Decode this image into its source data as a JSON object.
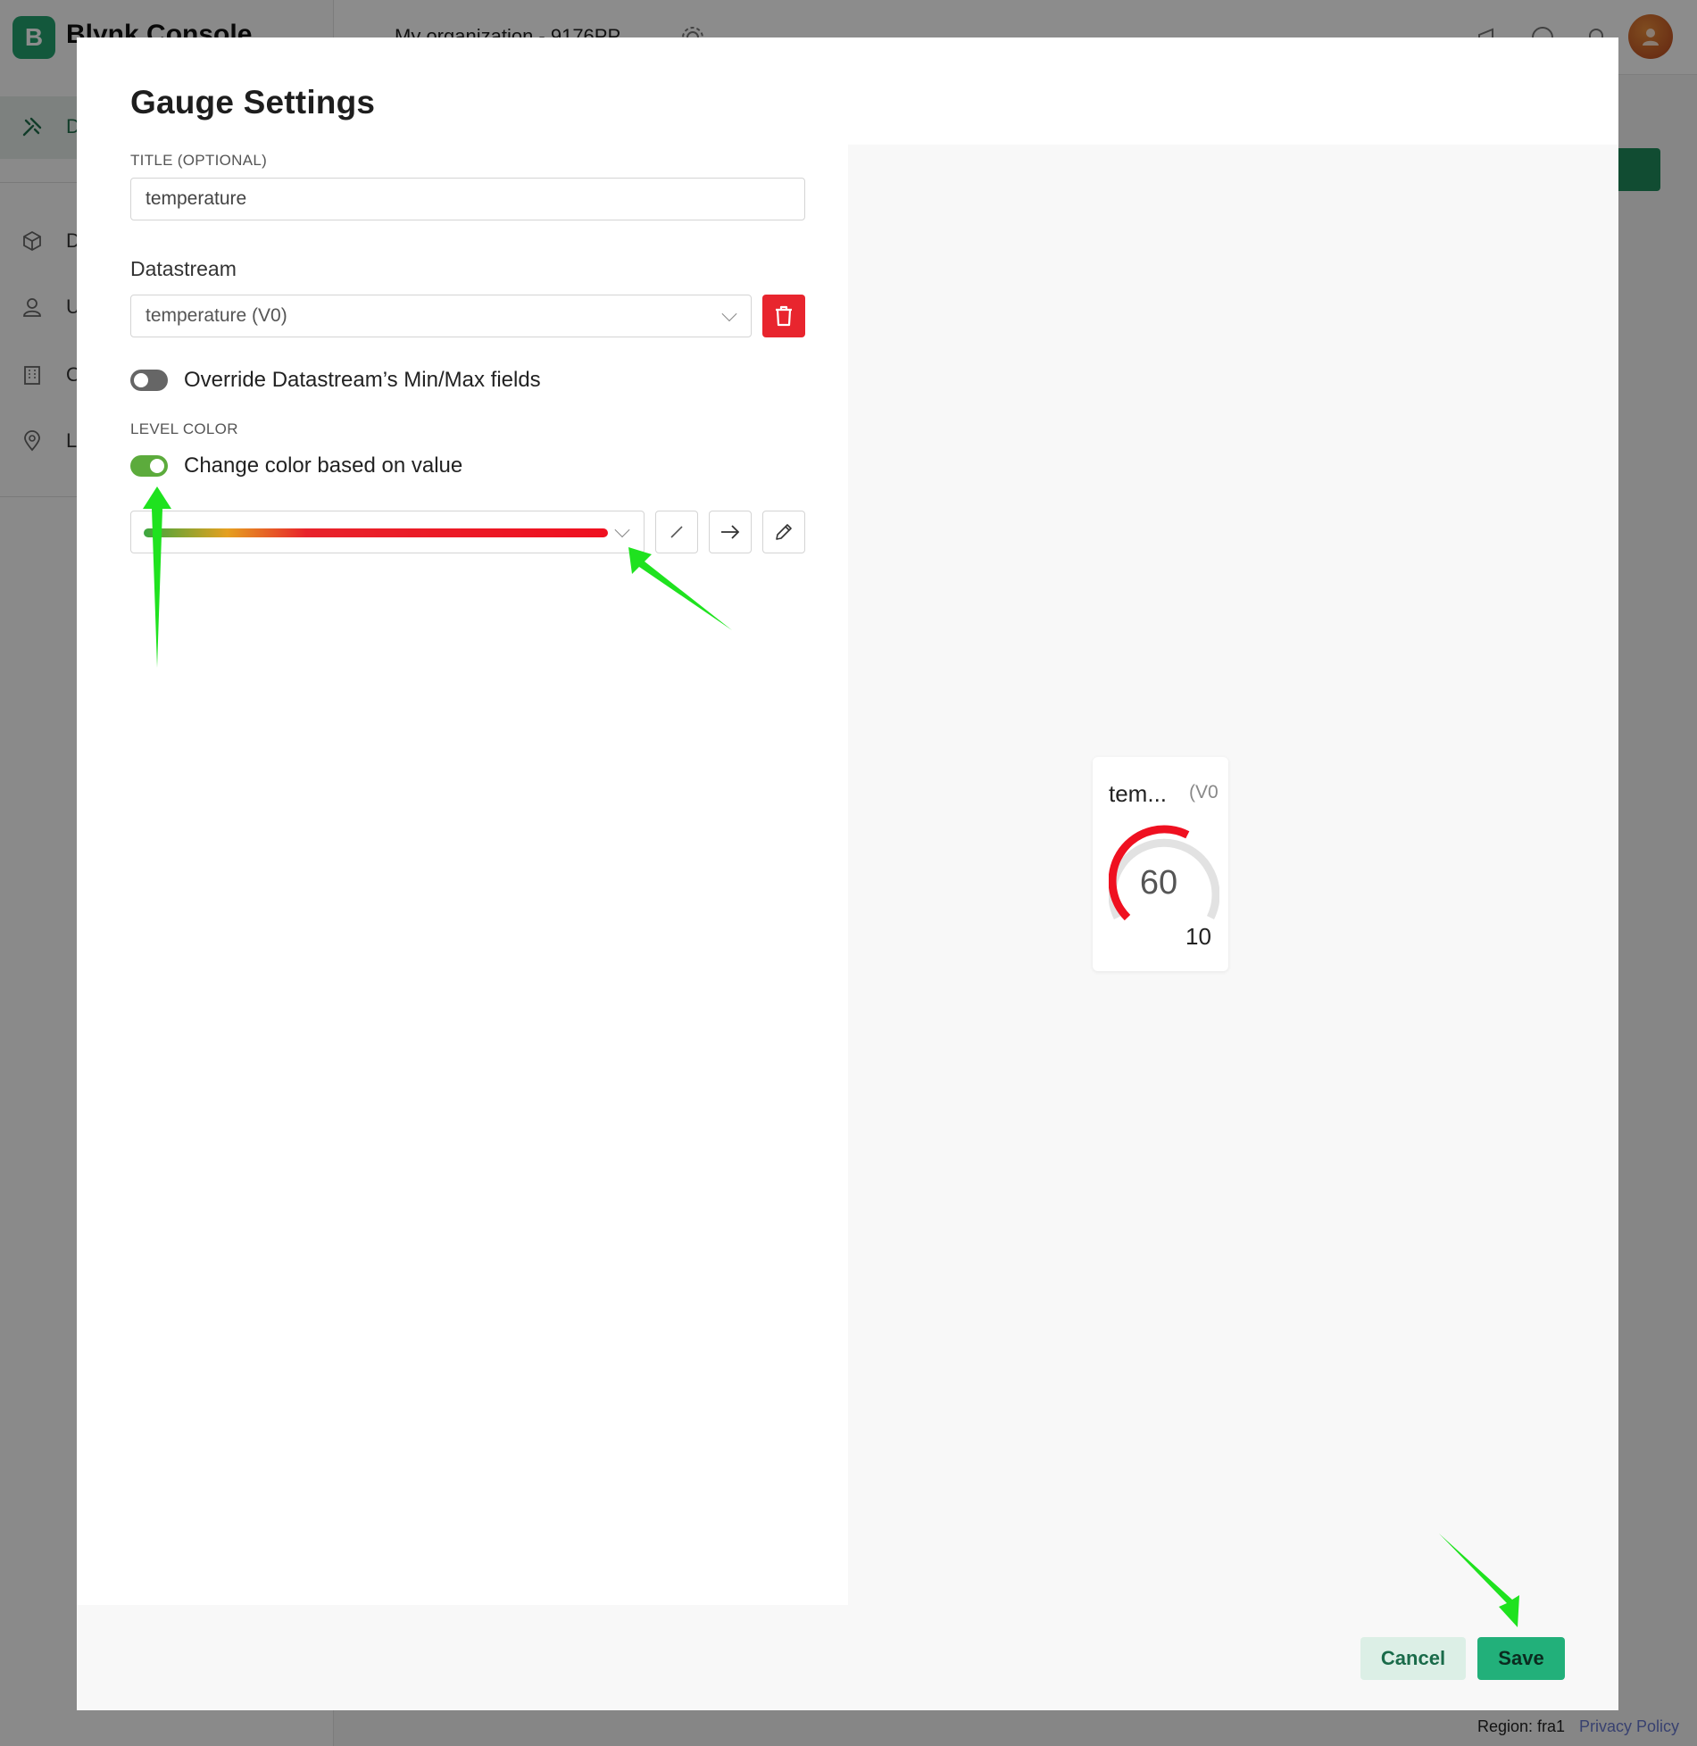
{
  "app": {
    "logo_letter": "B",
    "name": "Blynk.Console",
    "org_name": "My organization - 9176PP",
    "sidebar": [
      {
        "icon": "tools-icon",
        "letter": "D"
      },
      {
        "icon": "cube-icon",
        "letter": "D"
      },
      {
        "icon": "users-icon",
        "letter": "U"
      },
      {
        "icon": "building-icon",
        "letter": "O"
      },
      {
        "icon": "location-pin-icon",
        "letter": "L"
      }
    ],
    "footer": {
      "region": "Region: fra1",
      "privacy": "Privacy Policy"
    }
  },
  "modal": {
    "title": "Gauge Settings",
    "title_field": {
      "label": "TITLE (OPTIONAL)",
      "value": "temperature"
    },
    "datastream": {
      "label": "Datastream",
      "selected": "temperature (V0)"
    },
    "override_toggle": {
      "label": "Override Datastream’s Min/Max fields",
      "on": false
    },
    "level_color": {
      "label": "LEVEL COLOR",
      "toggle_label": "Change color based on value",
      "on": true,
      "gradient_colors": [
        "#3aa63f",
        "#e5a020",
        "#e8232b",
        "#ef1020"
      ]
    },
    "preview": {
      "title": "tem...",
      "datastream": "(V0",
      "value": "60",
      "max": "10",
      "level": 0.6
    },
    "buttons": {
      "cancel": "Cancel",
      "save": "Save"
    }
  },
  "colors": {
    "brand_green": "#22b07a",
    "delete_red": "#e8252e",
    "toggle_on": "#5cab3c",
    "annotation_arrow": "#1fe21f"
  }
}
